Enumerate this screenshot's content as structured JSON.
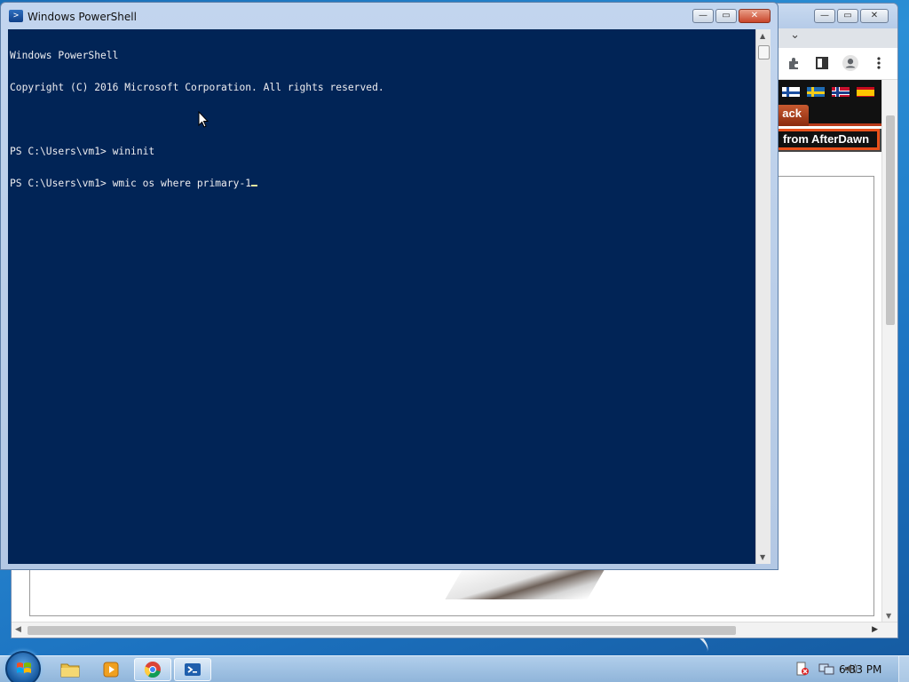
{
  "powershell": {
    "title": "Windows PowerShell",
    "lines": [
      "Windows PowerShell",
      "Copyright (C) 2016 Microsoft Corporation. All rights reserved.",
      "",
      "PS C:\\Users\\vm1> wininit",
      "PS C:\\Users\\vm1> wmic os where primary-1"
    ],
    "colors": {
      "background": "#012456",
      "text": "#eeedf0"
    }
  },
  "browser": {
    "nav_button": "ack",
    "banner_text": "from AfterDawn",
    "flags": [
      "finland-flag",
      "sweden-flag",
      "norway-flag",
      "spain-flag"
    ],
    "toolbar_icons": [
      "extensions-icon",
      "side-panel-icon",
      "profile-icon",
      "menu-icon"
    ]
  },
  "window_buttons": {
    "minimize": "—",
    "maximize": "▭",
    "close": "✕"
  },
  "taskbar": {
    "apps": [
      "file-explorer-icon",
      "media-player-icon",
      "chrome-icon",
      "powershell-icon"
    ],
    "tray_icons": [
      "action-center-icon",
      "network-icon",
      "volume-icon"
    ],
    "clock": "6:33 PM"
  }
}
